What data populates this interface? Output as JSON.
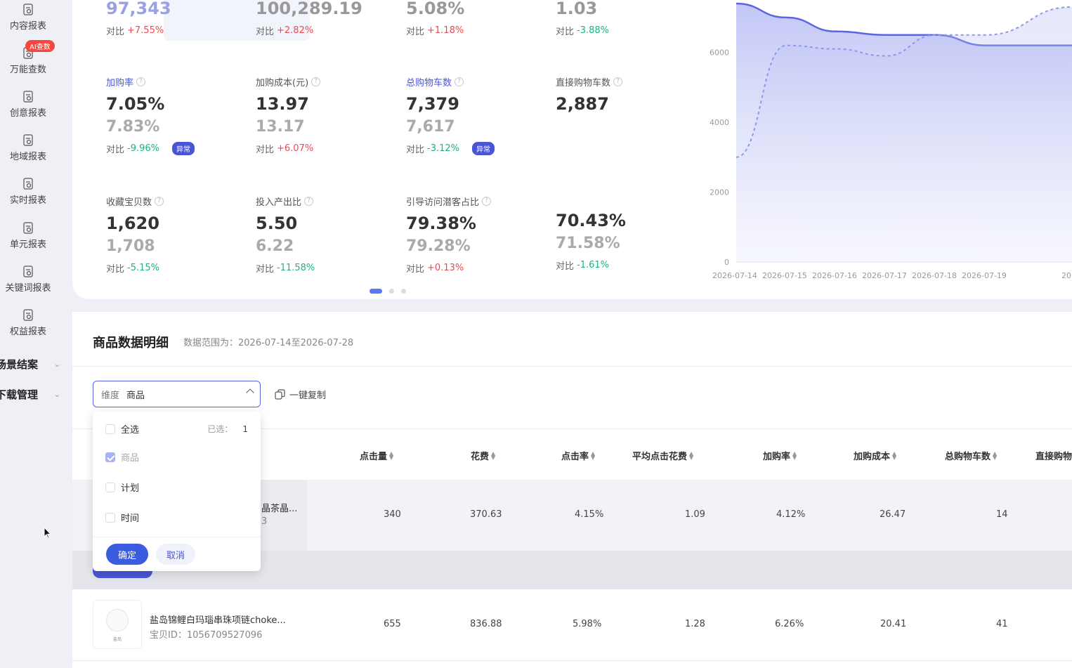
{
  "sidebar": {
    "items": [
      {
        "label": "内容报表"
      },
      {
        "label": "万能查数",
        "badge": "AI查数"
      },
      {
        "label": "创意报表"
      },
      {
        "label": "地域报表"
      },
      {
        "label": "实时报表"
      },
      {
        "label": "单元报表"
      },
      {
        "label": "关键词报表"
      },
      {
        "label": "权益报表"
      }
    ],
    "groups": [
      {
        "label": "场景结案"
      },
      {
        "label": "下载管理"
      }
    ]
  },
  "metrics": {
    "row0": [
      {
        "value": "97,343",
        "cmp_label": "对比",
        "cmp": "+7.55%"
      },
      {
        "value": "100,289.19",
        "cmp_label": "对比",
        "cmp": "+2.82%"
      },
      {
        "value": "5.08%",
        "cmp_label": "对比",
        "cmp": "+1.18%"
      },
      {
        "value": "1.03",
        "cmp_label": "对比",
        "cmp": "-3.88%"
      }
    ],
    "row1": [
      {
        "name": "加购率",
        "value": "7.05%",
        "prev": "7.83%",
        "cmp_label": "对比",
        "cmp": "-9.96%",
        "badge": "异常"
      },
      {
        "name": "加购成本(元)",
        "value": "13.97",
        "prev": "13.17",
        "cmp_label": "对比",
        "cmp": "+6.07%"
      },
      {
        "name": "总购物车数",
        "value": "7,379",
        "prev": "7,617",
        "cmp_label": "对比",
        "cmp": "-3.12%",
        "badge": "异常"
      },
      {
        "name": "直接购物车数",
        "value": "2,887"
      }
    ],
    "row2": [
      {
        "name": "收藏宝贝数",
        "value": "1,620",
        "prev": "1,708",
        "cmp_label": "对比",
        "cmp": "-5.15%"
      },
      {
        "name": "投入产出比",
        "value": "5.50",
        "prev": "6.22",
        "cmp_label": "对比",
        "cmp": "-11.58%"
      },
      {
        "name": "引导访问潜客占比",
        "value": "79.38%",
        "prev": "79.28%",
        "cmp_label": "对比",
        "cmp": "+0.13%"
      },
      {
        "name": "",
        "value": "70.43%",
        "prev": "71.58%",
        "cmp_label": "对比",
        "cmp": "-1.61%"
      }
    ]
  },
  "chart_data": {
    "type": "area",
    "x": [
      "2026-07-14",
      "2026-07-15",
      "2026-07-16",
      "2026-07-17",
      "2026-07-18",
      "2026-07-19",
      "20..."
    ],
    "yticks": [
      "0",
      "2000",
      "4000",
      "6000"
    ],
    "ylim": [
      0,
      7500
    ],
    "series": [
      {
        "values": [
          7400,
          7000,
          6600,
          6500,
          6500,
          6200,
          6200
        ],
        "color": "#5a66e0",
        "style": "solid"
      },
      {
        "values": [
          3000,
          6200,
          6100,
          5900,
          6500,
          6500,
          7300
        ],
        "color": "#8e97e8",
        "style": "dashed"
      }
    ],
    "grid": false,
    "legend": "none"
  },
  "detail": {
    "title": "商品数据明细",
    "range_label": "数据范围为：",
    "range": "2026-07-14至2026-07-28",
    "dimension_key": "维度",
    "dimension_value": "商品",
    "copy_label": "一键复制",
    "columns": [
      "点击量",
      "花费",
      "点击率",
      "平均点击花费",
      "加购率",
      "加购成本",
      "总购物车数",
      "直接购物"
    ],
    "rows": [
      {
        "name": "晶茶晶...",
        "id": "3",
        "cells": [
          "340",
          "370.63",
          "4.15%",
          "1.09",
          "4.12%",
          "26.47",
          "14"
        ]
      },
      {
        "name": "盐岛锦鲤白玛瑙串珠项链choke...",
        "id_label": "宝贝ID：",
        "id": "1056709527096",
        "thumb_text": "盐岛",
        "cells": [
          "655",
          "836.88",
          "5.98%",
          "1.28",
          "6.26%",
          "20.41",
          "41"
        ]
      }
    ]
  },
  "dropdown": {
    "select_all": "全选",
    "selected_label": "已选：",
    "selected_count": "1",
    "options": [
      {
        "label": "商品",
        "checked": true
      },
      {
        "label": "计划",
        "checked": false
      },
      {
        "label": "时间",
        "checked": false
      }
    ],
    "ok": "确定",
    "cancel": "取消"
  }
}
